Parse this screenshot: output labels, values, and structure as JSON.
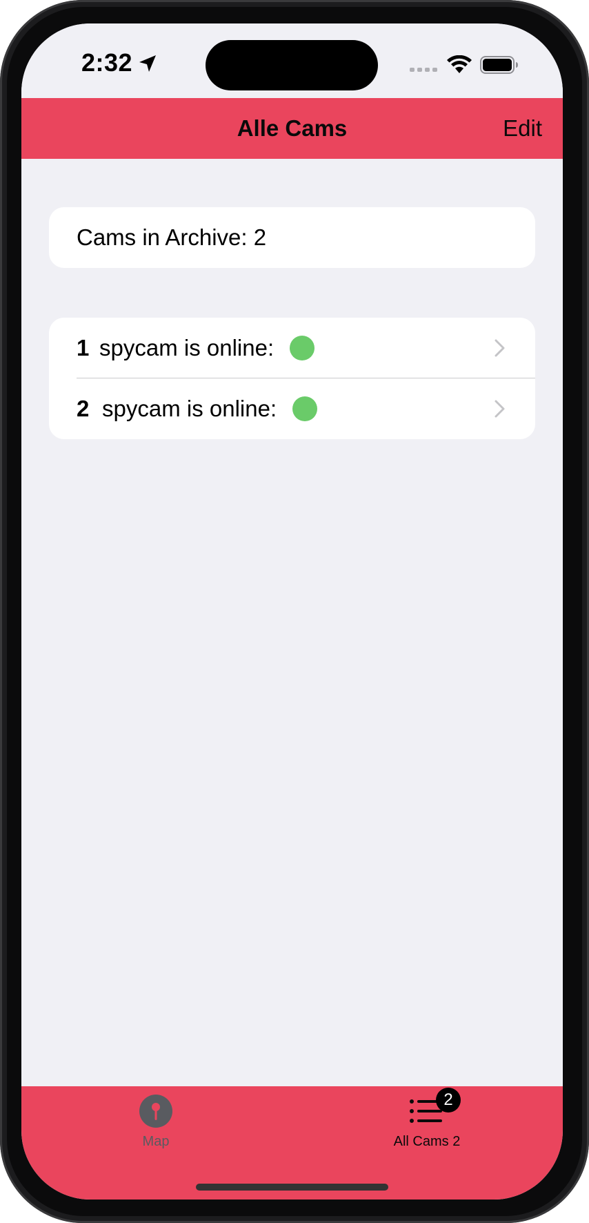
{
  "status_bar": {
    "time": "2:32"
  },
  "nav": {
    "title": "Alle Cams",
    "edit_label": "Edit"
  },
  "archive": {
    "text": "Cams in Archive: 2"
  },
  "cams": [
    {
      "number": "1",
      "label": "spycam is online:",
      "status_color": "#6acb69"
    },
    {
      "number": "2",
      "label": "spycam is online:",
      "status_color": "#6acb69"
    }
  ],
  "tab_bar": {
    "tabs": [
      {
        "label": "Map",
        "icon": "map-pin-icon",
        "selected": false
      },
      {
        "label": "All Cams 2",
        "icon": "list-icon",
        "selected": true,
        "badge": "2"
      }
    ]
  },
  "colors": {
    "accent": "#ea455d",
    "background": "#f0f0f5",
    "online": "#6acb69"
  }
}
